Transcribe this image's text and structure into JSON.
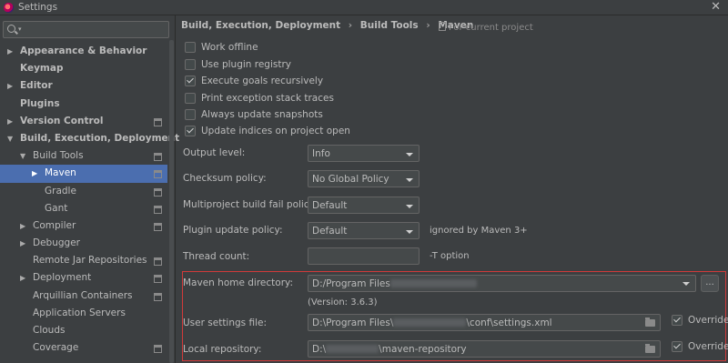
{
  "window": {
    "title": "Settings",
    "close_glyph": "✕"
  },
  "search": {
    "placeholder": "",
    "caret": "▾"
  },
  "tree": [
    {
      "label": "Appearance & Behavior",
      "arrow": "▶",
      "bold": true
    },
    {
      "label": "Keymap",
      "arrow": "",
      "bold": true
    },
    {
      "label": "Editor",
      "arrow": "▶",
      "bold": true
    },
    {
      "label": "Plugins",
      "arrow": "",
      "bold": true
    },
    {
      "label": "Version Control",
      "arrow": "▶",
      "bold": true,
      "scope": true
    },
    {
      "label": "Build, Execution, Deployment",
      "arrow": "▼",
      "bold": true
    },
    {
      "label": "Build Tools",
      "arrow": "▼",
      "scope": true
    },
    {
      "label": "Maven",
      "arrow": "▶",
      "scope": true,
      "selected": true
    },
    {
      "label": "Gradle",
      "arrow": "",
      "scope": true
    },
    {
      "label": "Gant",
      "arrow": "",
      "scope": true
    },
    {
      "label": "Compiler",
      "arrow": "▶",
      "scope": true
    },
    {
      "label": "Debugger",
      "arrow": "▶"
    },
    {
      "label": "Remote Jar Repositories",
      "arrow": "",
      "scope": true
    },
    {
      "label": "Deployment",
      "arrow": "▶",
      "scope": true
    },
    {
      "label": "Arquillian Containers",
      "arrow": "",
      "scope": true
    },
    {
      "label": "Application Servers",
      "arrow": ""
    },
    {
      "label": "Clouds",
      "arrow": ""
    },
    {
      "label": "Coverage",
      "arrow": "",
      "scope": true
    }
  ],
  "breadcrumb": {
    "part1": "Build, Execution, Deployment",
    "part2": "Build Tools",
    "part3": "Maven",
    "separator": "›",
    "for_project": "For current project"
  },
  "checkboxes": [
    {
      "label": "Work offline",
      "checked": false
    },
    {
      "label": "Use plugin registry",
      "checked": false
    },
    {
      "label": "Execute goals recursively",
      "checked": true
    },
    {
      "label": "Print exception stack traces",
      "checked": false
    },
    {
      "label": "Always update snapshots",
      "checked": false
    },
    {
      "label": "Update indices on project open",
      "checked": true
    }
  ],
  "fields": {
    "output_level": {
      "label": "Output level:",
      "value": "Info"
    },
    "checksum_policy": {
      "label": "Checksum policy:",
      "value": "No Global Policy"
    },
    "multiproject_fail": {
      "label": "Multiproject build fail policy:",
      "value": "Default"
    },
    "plugin_update": {
      "label": "Plugin update policy:",
      "value": "Default",
      "hint": "ignored by Maven 3+"
    },
    "thread_count": {
      "label": "Thread count:",
      "value": "",
      "hint": "-T option"
    }
  },
  "maven": {
    "home_label": "Maven home directory:",
    "home_value_prefix": "D:/Program Files",
    "browse_button": "...",
    "version": "(Version: 3.6.3)",
    "settings_label": "User settings file:",
    "settings_value_prefix": "D:\\Program Files\\",
    "settings_value_suffix": "\\conf\\settings.xml",
    "repo_label": "Local repository:",
    "repo_value_prefix": "D:\\",
    "repo_value_suffix": "\\maven-repository",
    "override_label": "Override",
    "settings_override": true,
    "repo_override": true
  },
  "colors": {
    "background": "#3c3f41",
    "selection": "#4b6eaf",
    "highlight_border": "#d03a3a"
  }
}
